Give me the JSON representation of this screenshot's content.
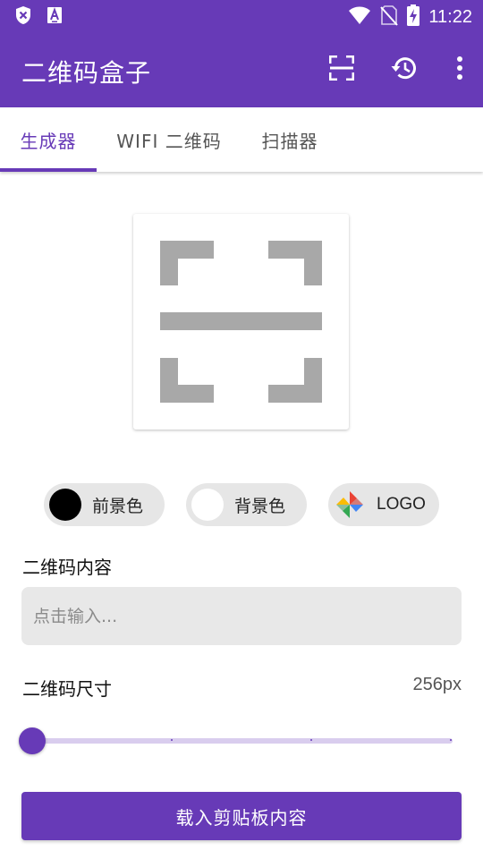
{
  "status_bar": {
    "time": "11:22",
    "icons": [
      "shield-icon",
      "font-a-icon",
      "wifi-icon",
      "no-sim-icon",
      "battery-charging-icon"
    ]
  },
  "app_bar": {
    "title": "二维码盒子",
    "actions": [
      "scan-icon",
      "history-icon",
      "more-vert-icon"
    ]
  },
  "tabs": [
    {
      "label": "生成器",
      "active": true
    },
    {
      "label": "WIFI 二维码",
      "active": false
    },
    {
      "label": "扫描器",
      "active": false
    }
  ],
  "preview": {
    "icon": "qr-scan-placeholder-icon"
  },
  "color_chips": {
    "foreground": {
      "label": "前景色",
      "color": "#000000"
    },
    "background": {
      "label": "背景色",
      "color": "#ffffff"
    },
    "logo": {
      "label": "LOGO",
      "icon": "pinwheel-icon"
    }
  },
  "content": {
    "label": "二维码内容",
    "value": "",
    "placeholder": "点击输入..."
  },
  "size": {
    "label": "二维码尺寸",
    "value_text": "256px",
    "slider_fraction": 0.0
  },
  "load_button": {
    "label": "载入剪贴板内容"
  },
  "colors": {
    "primary": "#673ab7",
    "chip_bg": "#e6e6e6",
    "input_bg": "#e8e8e8",
    "placeholder_gray": "#aaaaaa"
  }
}
